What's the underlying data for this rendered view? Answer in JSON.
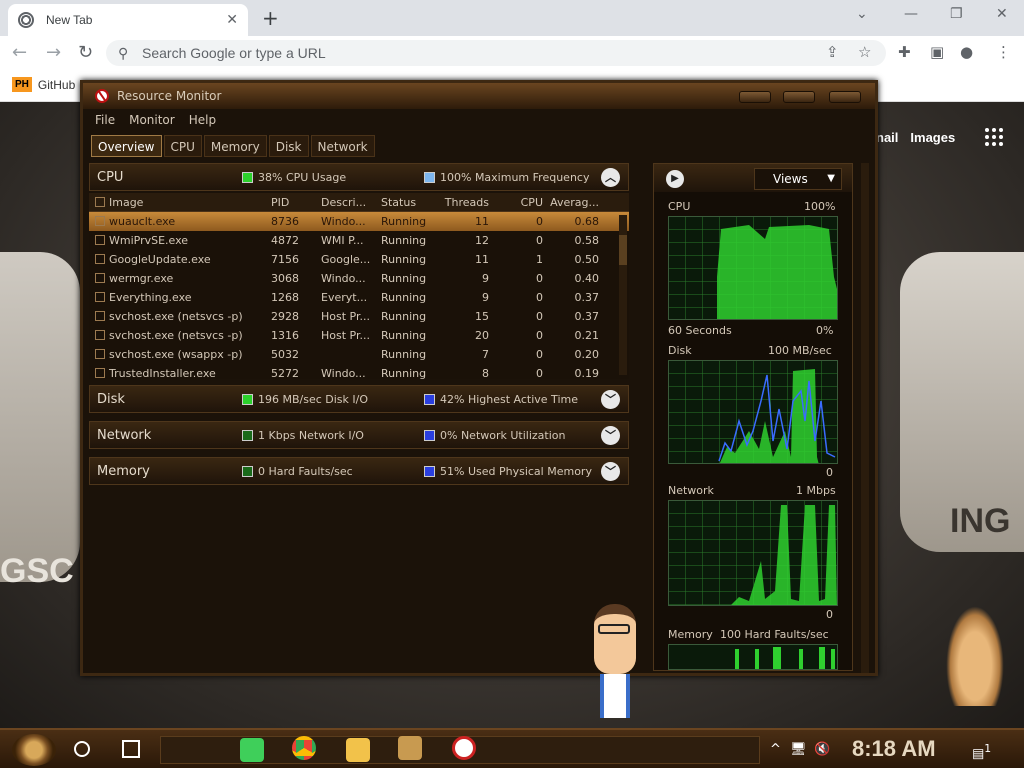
{
  "browser": {
    "tab_title": "New Tab",
    "omnibox_placeholder": "Search Google or type a URL",
    "bookmark_label": "GitHub",
    "bookmark_icon_text": "PH",
    "google_links": [
      "nail",
      "Images"
    ]
  },
  "window": {
    "title": "Resource Monitor",
    "menu": [
      "File",
      "Monitor",
      "Help"
    ],
    "tabs": [
      "Overview",
      "CPU",
      "Memory",
      "Disk",
      "Network"
    ],
    "active_tab": "Overview"
  },
  "cpu_section": {
    "name": "CPU",
    "indicator1": "38% CPU Usage",
    "indicator2": "100% Maximum Frequency",
    "columns": [
      "Image",
      "PID",
      "Descri...",
      "Status",
      "Threads",
      "CPU",
      "Averag..."
    ],
    "rows": [
      [
        "wuauclt.exe",
        "8736",
        "Windo...",
        "Running",
        "11",
        "0",
        "0.68"
      ],
      [
        "WmiPrvSE.exe",
        "4872",
        "WMI P...",
        "Running",
        "12",
        "0",
        "0.58"
      ],
      [
        "GoogleUpdate.exe",
        "7156",
        "Google...",
        "Running",
        "11",
        "1",
        "0.50"
      ],
      [
        "wermgr.exe",
        "3068",
        "Windo...",
        "Running",
        "9",
        "0",
        "0.40"
      ],
      [
        "Everything.exe",
        "1268",
        "Everyt...",
        "Running",
        "9",
        "0",
        "0.37"
      ],
      [
        "svchost.exe (netsvcs -p)",
        "2928",
        "Host Pr...",
        "Running",
        "15",
        "0",
        "0.37"
      ],
      [
        "svchost.exe (netsvcs -p)",
        "1316",
        "Host Pr...",
        "Running",
        "20",
        "0",
        "0.21"
      ],
      [
        "svchost.exe (wsappx -p)",
        "5032",
        "",
        "Running",
        "7",
        "0",
        "0.20"
      ],
      [
        "TrustedInstaller.exe",
        "5272",
        "Windo...",
        "Running",
        "8",
        "0",
        "0.19"
      ]
    ]
  },
  "disk_section": {
    "name": "Disk",
    "indicator1": "196 MB/sec Disk I/O",
    "indicator2": "42% Highest Active Time"
  },
  "network_section": {
    "name": "Network",
    "indicator1": "1 Kbps Network I/O",
    "indicator2": "0% Network Utilization"
  },
  "memory_section": {
    "name": "Memory",
    "indicator1": "0 Hard Faults/sec",
    "indicator2": "51% Used Physical Memory"
  },
  "graphs": {
    "views_label": "Views",
    "cpu": {
      "title": "CPU",
      "max": "100%",
      "bottom_left": "60 Seconds",
      "bottom_right": "0%"
    },
    "disk": {
      "title": "Disk",
      "max": "100 MB/sec",
      "bottom_right": "0"
    },
    "network": {
      "title": "Network",
      "max": "1 Mbps",
      "bottom_right": "0"
    },
    "memory": {
      "title": "Memory",
      "max": "100 Hard Faults/sec"
    }
  },
  "taskbar": {
    "clock": "8:18 AM",
    "notification_count": "1"
  },
  "wallpaper_text": {
    "left": "GSC",
    "right": "ING"
  }
}
